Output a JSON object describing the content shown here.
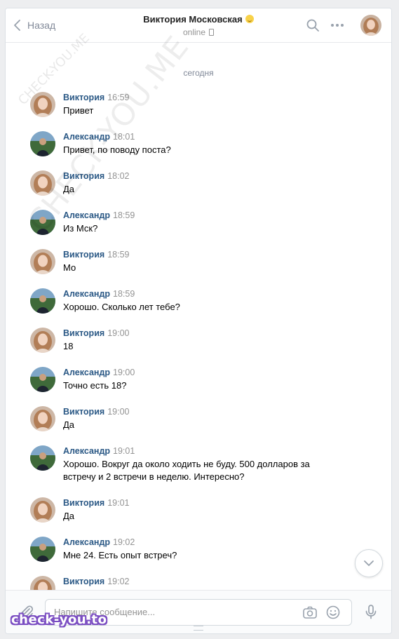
{
  "header": {
    "back_label": "Назад",
    "contact_name": "Виктория Московская",
    "status": "online"
  },
  "composer": {
    "placeholder": "Напишите сообщение..."
  },
  "feed": {
    "date_label": "сегодня",
    "messages": [
      {
        "author": "Виктория",
        "time": "16:59",
        "text": "Привет"
      },
      {
        "author": "Александр",
        "time": "18:01",
        "text": "Привет, по поводу поста?"
      },
      {
        "author": "Виктория",
        "time": "18:02",
        "text": "Да"
      },
      {
        "author": "Александр",
        "time": "18:59",
        "text": "Из Мск?"
      },
      {
        "author": "Виктория",
        "time": "18:59",
        "text": "Мо"
      },
      {
        "author": "Александр",
        "time": "18:59",
        "text": "Хорошо. Сколько лет тебе?"
      },
      {
        "author": "Виктория",
        "time": "19:00",
        "text": "18"
      },
      {
        "author": "Александр",
        "time": "19:00",
        "text": "Точно есть 18?"
      },
      {
        "author": "Виктория",
        "time": "19:00",
        "text": "Да"
      },
      {
        "author": "Александр",
        "time": "19:01",
        "text": "Хорошо. Вокруг да около ходить не буду. 500 долларов за встречу и 2 встречи в неделю. Интересно?"
      },
      {
        "author": "Виктория",
        "time": "19:01",
        "text": "Да"
      },
      {
        "author": "Александр",
        "time": "19:02",
        "text": "Мне 24. Есть опыт встреч?"
      },
      {
        "author": "Виктория",
        "time": "19:02",
        "text": ""
      }
    ]
  },
  "watermarks": {
    "diagonal": "CHECK-YOU.ME",
    "small": "CHECK-YOU.ME",
    "bottom": "check-you.to"
  },
  "colors": {
    "background": "#edeef0",
    "author_link": "#2a5885",
    "muted": "#828a99"
  }
}
